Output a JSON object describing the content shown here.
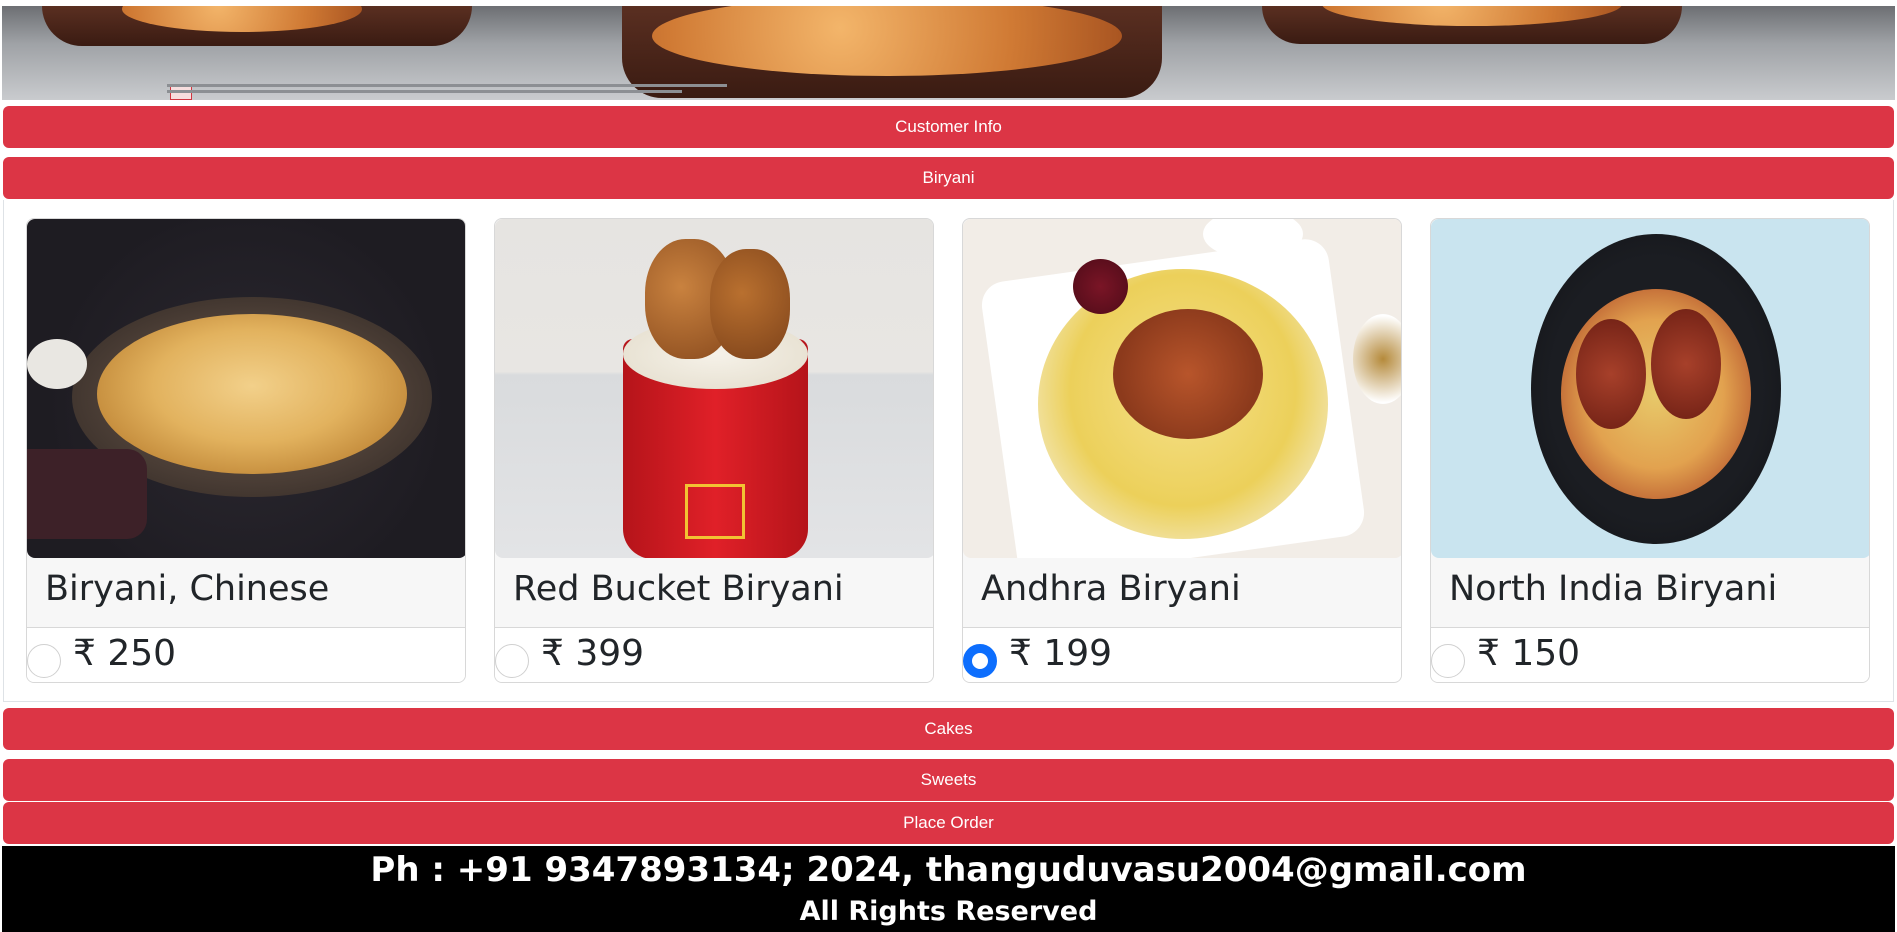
{
  "accordion": {
    "customer_info": "Customer Info",
    "biryani": "Biryani",
    "cakes": "Cakes",
    "sweets": "Sweets",
    "place_order": "Place Order"
  },
  "biryani_items": [
    {
      "name": "Biryani, Chinese",
      "price": "₹ 250",
      "selected": false
    },
    {
      "name": "Red Bucket Biryani",
      "price": "₹ 399",
      "selected": false
    },
    {
      "name": "Andhra Biryani",
      "price": "₹ 199",
      "selected": true
    },
    {
      "name": "North India Biryani",
      "price": "₹ 150",
      "selected": false
    }
  ],
  "footer": {
    "contact": "Ph : +91 9347893134; 2024, thanguduvasu2004@gmail.com",
    "rights": "All Rights Reserved"
  },
  "colors": {
    "accent": "#dc3545",
    "radio_selected": "#0d6efd",
    "footer_bg": "#000000"
  }
}
